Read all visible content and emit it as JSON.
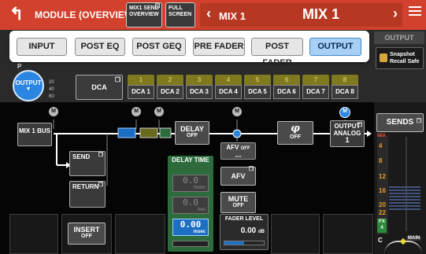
{
  "header": {
    "title": "MODULE (OVERVIEW)",
    "tab_send_overview": "MIX1 SEND OVERVIEW",
    "tab_full_screen": "FULL SCREEN",
    "mix_prev_label": "MIX 1",
    "mix_current_label": "MIX 1",
    "accent_color": "#d2412d"
  },
  "popup": {
    "options": [
      "INPUT",
      "POST EQ",
      "POST GEQ",
      "PRE FADER",
      "POST FADER",
      "OUTPUT"
    ],
    "selected": "OUTPUT"
  },
  "top_right": {
    "output_tab": "OUTPUT",
    "snapshot_label": "Snapshot Recall Safe"
  },
  "knob": {
    "label": "OUTPUT",
    "partial_label": "P"
  },
  "scale": [
    "20",
    "40",
    "60"
  ],
  "dca": {
    "main_label": "DCA",
    "slots": [
      {
        "num": "1",
        "name": "DCA 1"
      },
      {
        "num": "2",
        "name": "DCA 2"
      },
      {
        "num": "3",
        "name": "DCA 3"
      },
      {
        "num": "4",
        "name": "DCA 4"
      },
      {
        "num": "5",
        "name": "DCA 5"
      },
      {
        "num": "6",
        "name": "DCA 6"
      },
      {
        "num": "7",
        "name": "DCA 7"
      },
      {
        "num": "8",
        "name": "DCA 8"
      }
    ]
  },
  "routing": {
    "m_label": "M",
    "mix_bus": "MIX 1 BUS",
    "send": "SEND",
    "return": "RETURN",
    "delay": "DELAY",
    "delay_state": "OFF",
    "phase_state": "OFF",
    "output_box": "OUTPUT",
    "output_dest": "ANALOG",
    "output_num": "1",
    "afv_off": "AFV",
    "afv_off_state": "OFF",
    "afv_dashes": "---",
    "afv": "AFV",
    "mute": "MUTE",
    "mute_state": "OFF",
    "insert": "INSERT",
    "insert_state": "OFF"
  },
  "delay_time": {
    "title": "DELAY TIME",
    "meter_value": "0.0",
    "meter_unit": "meter",
    "feet_value": "0.0",
    "feet_unit": "feet",
    "msec_value": "0.00",
    "msec_unit": "msec"
  },
  "fader": {
    "title": "FADER LEVEL",
    "value": "0.00",
    "unit": "dB"
  },
  "sends": {
    "label": "SENDS",
    "mix_label": "MIX",
    "numbers": [
      "4",
      "8",
      "12",
      "16",
      "20",
      "22"
    ],
    "fx_label": "FX",
    "fx_num": "4",
    "c_label": "C",
    "main_label": "MAIN"
  }
}
